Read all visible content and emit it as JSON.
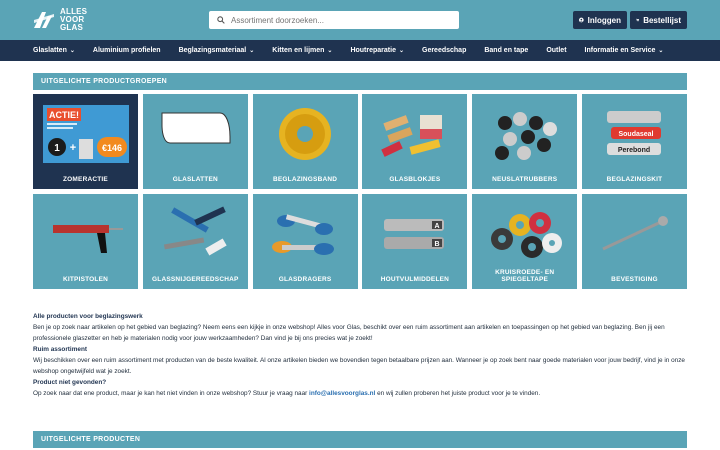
{
  "header": {
    "logo_line1": "ALLES",
    "logo_line2": "VOOR",
    "logo_line3": "GLAS",
    "search_placeholder": "Assortiment doorzoeken...",
    "login_label": "Inloggen",
    "cart_label": "Bestellijst"
  },
  "nav": [
    {
      "label": "Glaslatten",
      "dropdown": true
    },
    {
      "label": "Aluminium profielen",
      "dropdown": false
    },
    {
      "label": "Beglazingsmateriaal",
      "dropdown": true
    },
    {
      "label": "Kitten en lijmen",
      "dropdown": true
    },
    {
      "label": "Houtreparatie",
      "dropdown": true
    },
    {
      "label": "Gereedschap",
      "dropdown": false
    },
    {
      "label": "Band en tape",
      "dropdown": false
    },
    {
      "label": "Outlet",
      "dropdown": false
    },
    {
      "label": "Informatie en Service",
      "dropdown": true
    }
  ],
  "featured_groups_title": "UITGELICHTE PRODUCTGROEPEN",
  "tiles": [
    {
      "label": "ZOMERACTIE",
      "icon": "promo-image",
      "promo_title": "ACTIE!",
      "promo_price": "€146"
    },
    {
      "label": "GLASLATTEN",
      "icon": "glass-strip-image"
    },
    {
      "label": "BEGLAZINGSBAND",
      "icon": "tape-roll-image"
    },
    {
      "label": "GLASBLOKJES",
      "icon": "glass-blocks-image"
    },
    {
      "label": "NEUSLATRUBBERS",
      "icon": "rubber-pads-image"
    },
    {
      "label": "BEGLAZINGSKIT",
      "icon": "kit-tubes-image",
      "brand1": "Soudaseal",
      "brand2": "Perebond"
    },
    {
      "label": "KITPISTOLEN",
      "icon": "caulk-gun-image"
    },
    {
      "label": "GLASSNIJGEREEDSCHAP",
      "icon": "glass-cutter-image"
    },
    {
      "label": "GLASDRAGERS",
      "icon": "suction-lifter-image"
    },
    {
      "label": "HOUTVULMIDDELEN",
      "icon": "wood-filler-image",
      "tag_a": "A",
      "tag_b": "B"
    },
    {
      "label": "KRUISROEDE- EN SPIEGELTAPE",
      "icon": "tape-rolls-image"
    },
    {
      "label": "BEVESTIGING",
      "icon": "screw-image"
    }
  ],
  "text": {
    "h1": "Alle producten voor beglazingswerk",
    "p1": "Ben je op zoek naar artikelen op het gebied van beglazing? Neem eens een kijkje in onze webshop! Alles voor Glas, beschikt over een ruim assortiment aan artikelen en toepassingen op het gebied van beglazing. Ben jij een professionele glaszetter en heb je materialen nodig voor jouw werkzaamheden? Dan vind je bij ons precies wat je zoekt!",
    "h2": "Ruim assortiment",
    "p2": "Wij beschikken over een ruim assortiment met producten van de beste kwaliteit. Al onze artikelen bieden we bovendien tegen betaalbare prijzen aan. Wanneer je op zoek bent naar goede materialen voor jouw bedrijf, vind je in onze webshop ongetwijfeld wat je zoekt.",
    "h3": "Product niet gevonden?",
    "p3_before": "Op zoek naar dat ene product, maar je kan het niet vinden in onze webshop? Stuur je vraag naar ",
    "p3_link": "info@allesvoorglas.nl",
    "p3_after": " en wij zullen proberen het juiste product voor je te vinden."
  },
  "featured_products_title": "UITGELICHTE PRODUCTEN",
  "colors": {
    "teal": "#5aa4b6",
    "navy": "#1f3350"
  }
}
